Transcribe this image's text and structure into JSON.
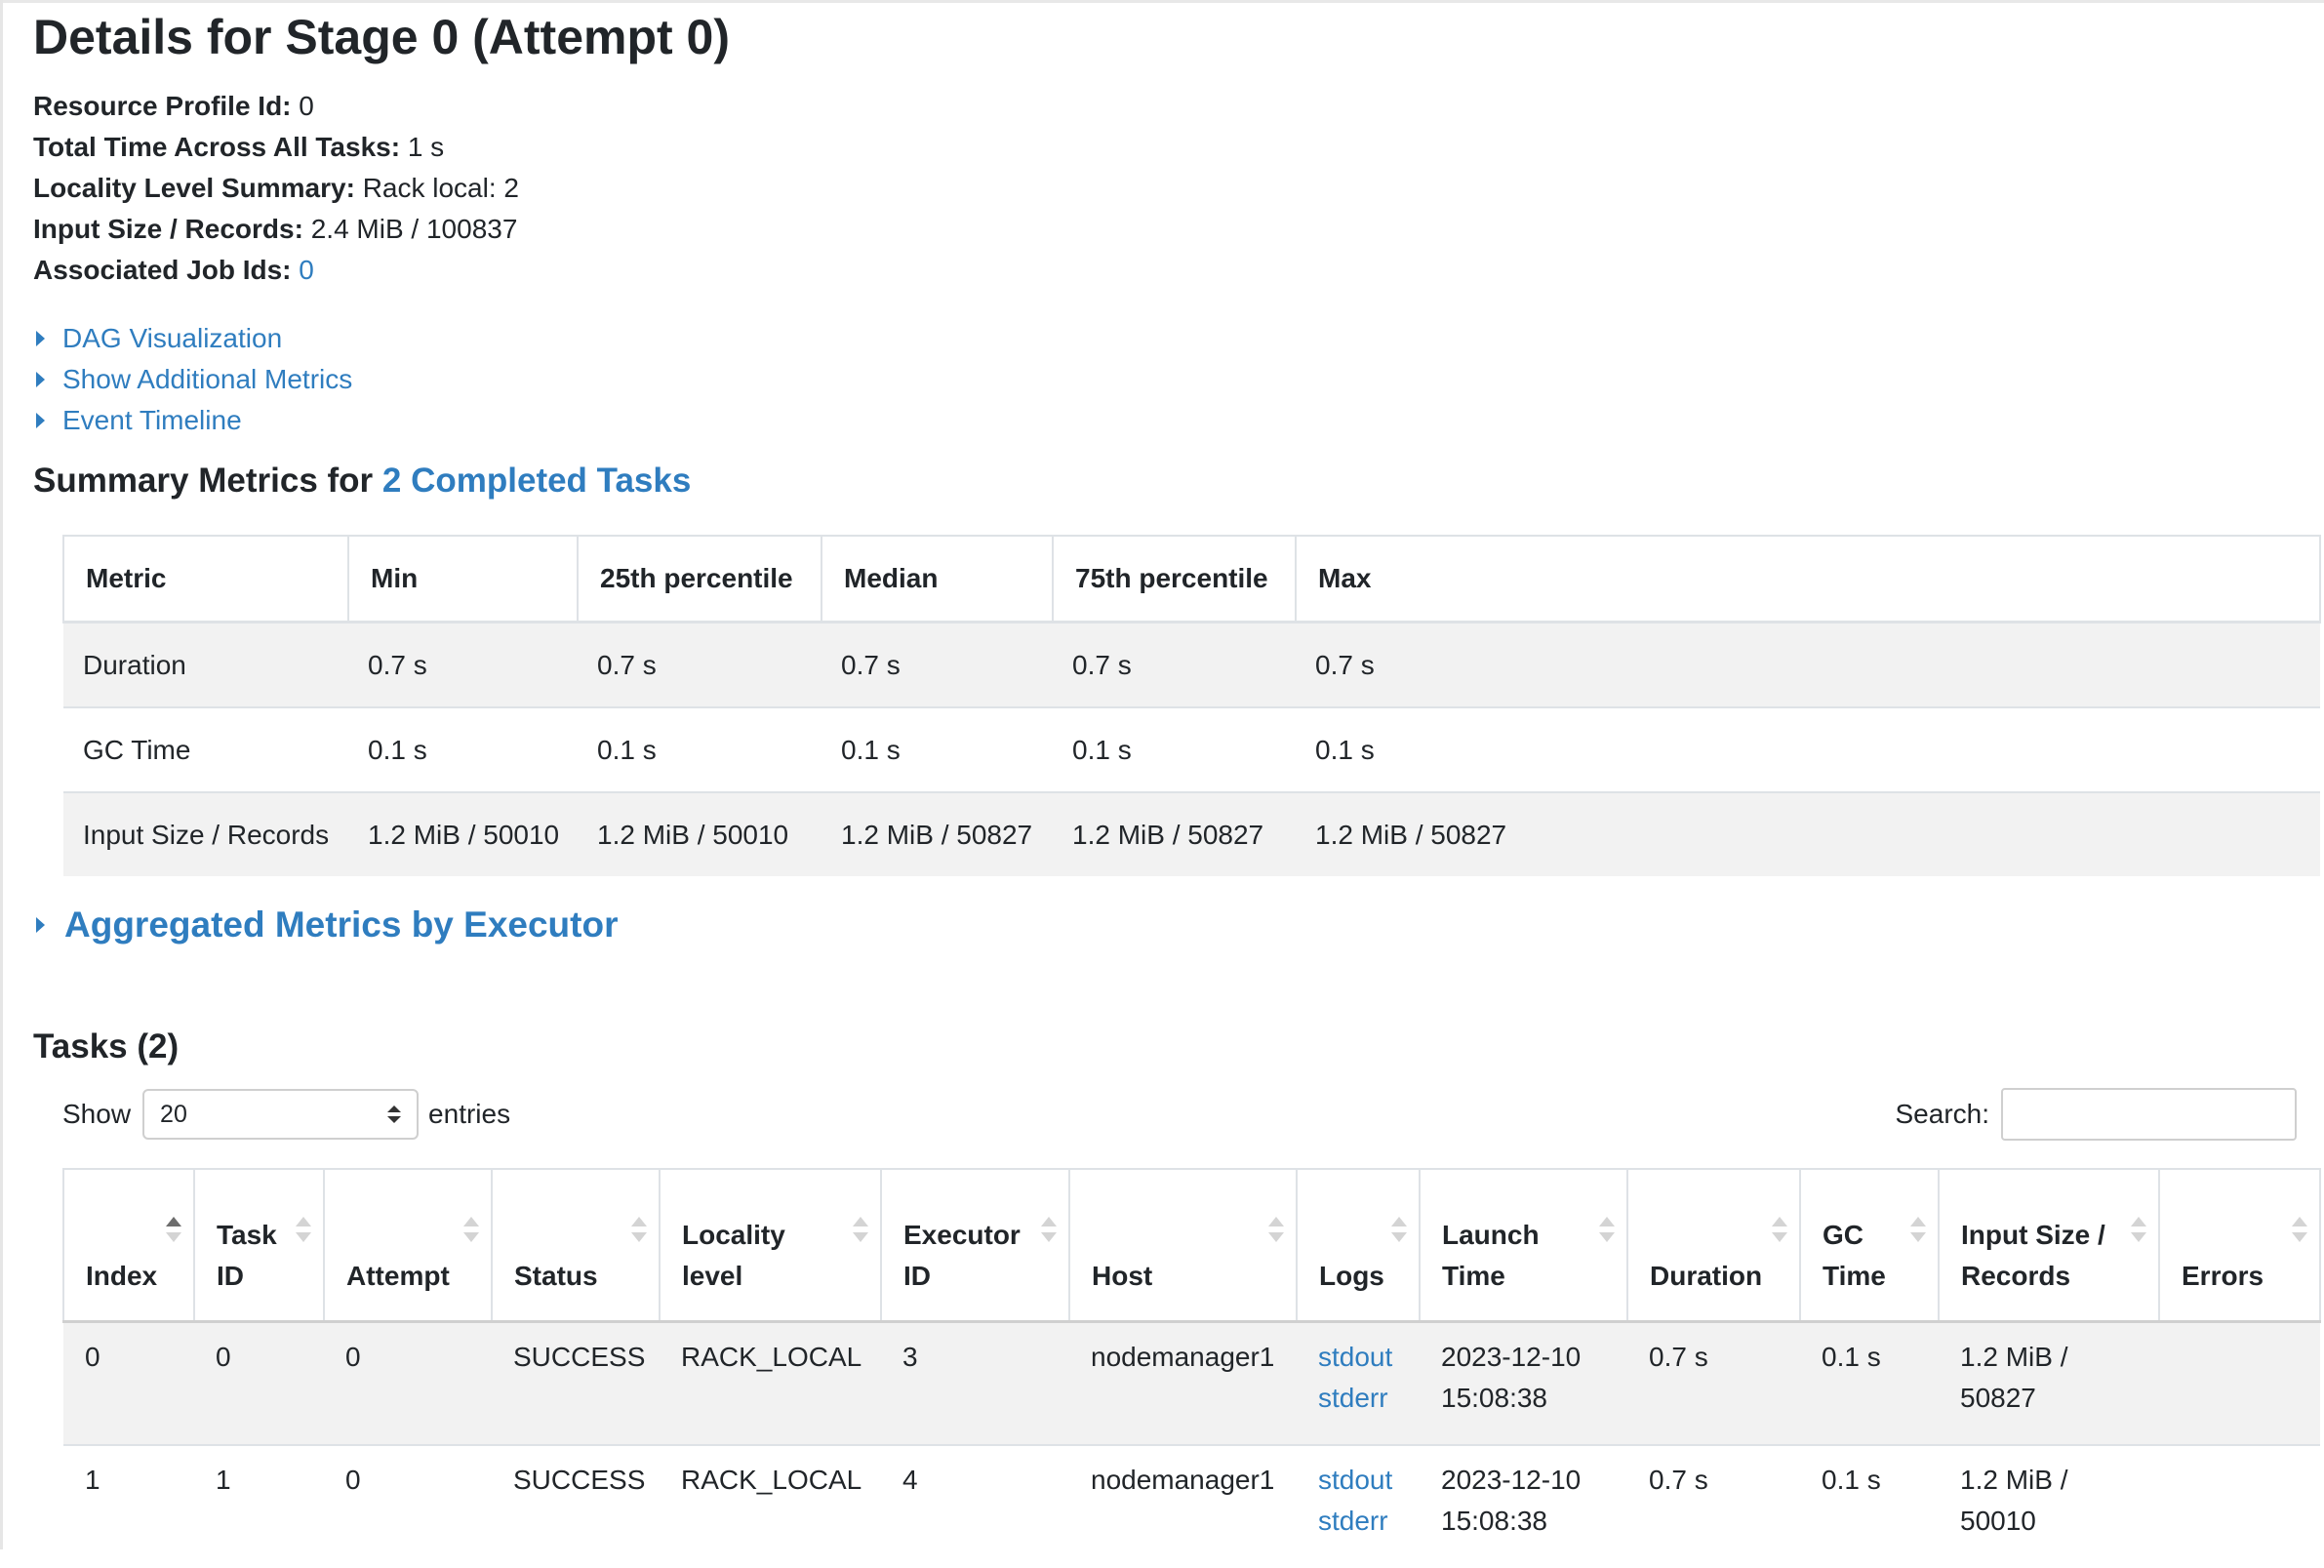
{
  "page": {
    "title": "Details for Stage 0 (Attempt 0)"
  },
  "summary": {
    "resource_profile": {
      "label": "Resource Profile Id:",
      "value": "0"
    },
    "total_time": {
      "label": "Total Time Across All Tasks:",
      "value": "1 s"
    },
    "locality": {
      "label": "Locality Level Summary:",
      "value": "Rack local: 2"
    },
    "input_size": {
      "label": "Input Size / Records:",
      "value": "2.4 MiB / 100837"
    },
    "job_ids": {
      "label": "Associated Job Ids:",
      "value": "0"
    }
  },
  "toggles": {
    "dag": "DAG Visualization",
    "additional_metrics": "Show Additional Metrics",
    "event_timeline": "Event Timeline"
  },
  "summary_metrics": {
    "heading_prefix": "Summary Metrics for",
    "heading_link": "2 Completed Tasks",
    "columns": [
      "Metric",
      "Min",
      "25th percentile",
      "Median",
      "75th percentile",
      "Max"
    ],
    "rows": [
      [
        "Duration",
        "0.7 s",
        "0.7 s",
        "0.7 s",
        "0.7 s",
        "0.7 s"
      ],
      [
        "GC Time",
        "0.1 s",
        "0.1 s",
        "0.1 s",
        "0.1 s",
        "0.1 s"
      ],
      [
        "Input Size / Records",
        "1.2 MiB / 50010",
        "1.2 MiB / 50010",
        "1.2 MiB / 50827",
        "1.2 MiB / 50827",
        "1.2 MiB / 50827"
      ]
    ]
  },
  "aggregated": {
    "label": "Aggregated Metrics by Executor"
  },
  "tasks": {
    "heading": "Tasks (2)",
    "show_label": "Show",
    "page_length": "20",
    "entries_label": "entries",
    "search_label": "Search:",
    "search_value": "",
    "columns": [
      {
        "line1": "",
        "line2": "Index"
      },
      {
        "line1": "Task",
        "line2": "ID"
      },
      {
        "line1": "",
        "line2": "Attempt"
      },
      {
        "line1": "",
        "line2": "Status"
      },
      {
        "line1": "Locality",
        "line2": "level"
      },
      {
        "line1": "Executor",
        "line2": "ID"
      },
      {
        "line1": "",
        "line2": "Host"
      },
      {
        "line1": "",
        "line2": "Logs"
      },
      {
        "line1": "Launch",
        "line2": "Time"
      },
      {
        "line1": "",
        "line2": "Duration"
      },
      {
        "line1": "GC",
        "line2": "Time"
      },
      {
        "line1": "Input Size /",
        "line2": "Records"
      },
      {
        "line1": "",
        "line2": "Errors"
      }
    ],
    "rows": [
      {
        "index": "0",
        "task_id": "0",
        "attempt": "0",
        "status": "SUCCESS",
        "locality": "RACK_LOCAL",
        "executor_id": "3",
        "host": "nodemanager1",
        "log_stdout": "stdout",
        "log_stderr": "stderr",
        "launch_date": "2023-12-10",
        "launch_time": "15:08:38",
        "duration": "0.7 s",
        "gc_time": "0.1 s",
        "input_size": "1.2 MiB /",
        "input_records": "50827",
        "errors": ""
      },
      {
        "index": "1",
        "task_id": "1",
        "attempt": "0",
        "status": "SUCCESS",
        "locality": "RACK_LOCAL",
        "executor_id": "4",
        "host": "nodemanager1",
        "log_stdout": "stdout",
        "log_stderr": "stderr",
        "launch_date": "2023-12-10",
        "launch_time": "15:08:38",
        "duration": "0.7 s",
        "gc_time": "0.1 s",
        "input_size": "1.2 MiB /",
        "input_records": "50010",
        "errors": ""
      }
    ]
  },
  "colors": {
    "link": "#2f7dbf",
    "stripe": "#f2f2f2",
    "border": "#dee2e6"
  }
}
